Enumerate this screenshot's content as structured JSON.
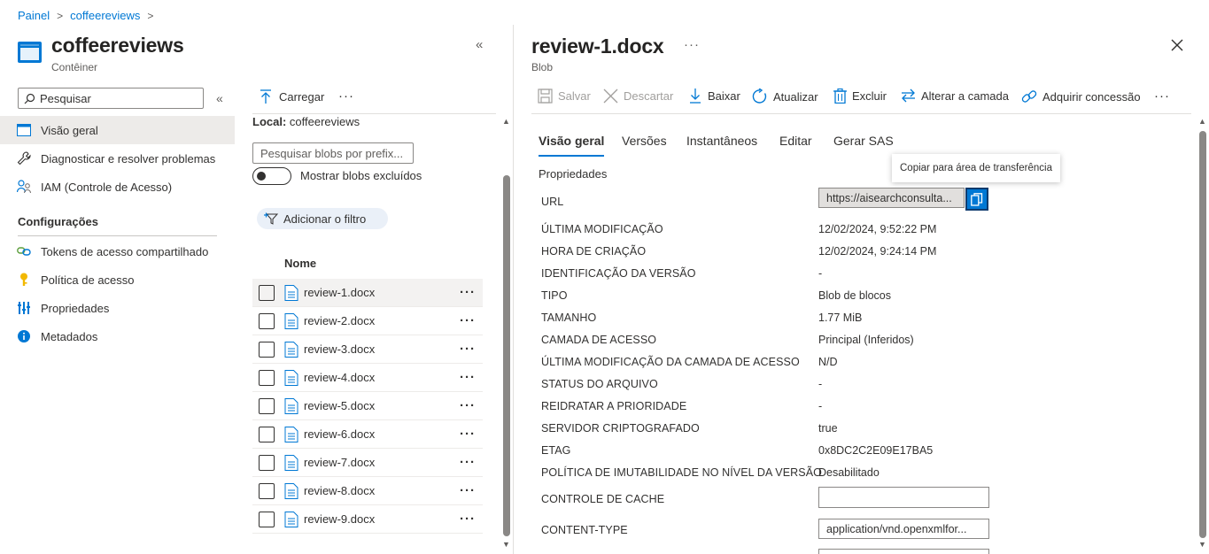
{
  "breadcrumb": [
    "Painel",
    "coffeereviews"
  ],
  "container": {
    "title": "coffeereviews",
    "subtitle": "Contêiner"
  },
  "nav": {
    "search_placeholder": "Pesquisar",
    "items": [
      {
        "label": "Visão geral",
        "icon": "overview-icon",
        "selected": true
      },
      {
        "label": "Diagnosticar e resolver problemas",
        "icon": "wrench-icon"
      },
      {
        "label": "IAM (Controle de Acesso)",
        "icon": "people-icon"
      }
    ],
    "section": "Configurações",
    "settings": [
      {
        "label": "Tokens de acesso compartilhado",
        "icon": "link-icon"
      },
      {
        "label": "Política de acesso",
        "icon": "key-icon"
      },
      {
        "label": "Propriedades",
        "icon": "properties-icon"
      },
      {
        "label": "Metadados",
        "icon": "info-icon"
      }
    ]
  },
  "blobs": {
    "upload_label": "Carregar",
    "local_label": "Local:",
    "local_value": "coffeereviews",
    "search_placeholder": "Pesquisar blobs por prefix...",
    "toggle_label": "Mostrar blobs excluídos",
    "filter_label": "Adicionar o filtro",
    "column_header": "Nome",
    "files": [
      "review-1.docx",
      "review-2.docx",
      "review-3.docx",
      "review-4.docx",
      "review-5.docx",
      "review-6.docx",
      "review-7.docx",
      "review-8.docx",
      "review-9.docx"
    ],
    "selected_index": 0
  },
  "blade": {
    "title": "review-1.docx",
    "subtitle": "Blob",
    "commands": {
      "save": "Salvar",
      "discard": "Descartar",
      "download": "Baixar",
      "refresh": "Atualizar",
      "delete": "Excluir",
      "change_tier": "Alterar a camada",
      "lease": "Adquirir concessão"
    },
    "tabs": [
      "Visão geral",
      "Versões",
      "Instantâneos",
      "Editar",
      "Gerar SAS"
    ],
    "properties_title": "Propriedades",
    "tooltip": "Copiar para área de transferência",
    "url_label": "URL",
    "url_value": "https://aisearchconsulta...",
    "properties": [
      {
        "label": "ÚLTIMA MODIFICAÇÃO",
        "value": "12/02/2024, 9:52:22 PM"
      },
      {
        "label": "HORA DE CRIAÇÃO",
        "value": "12/02/2024, 9:24:14 PM"
      },
      {
        "label": "IDENTIFICAÇÃO DA VERSÃO",
        "value": "-"
      },
      {
        "label": "TIPO",
        "value": "Blob de blocos"
      },
      {
        "label": "TAMANHO",
        "value": "1.77 MiB"
      },
      {
        "label": "CAMADA DE ACESSO",
        "value": "Principal (Inferidos)"
      },
      {
        "label": "ÚLTIMA MODIFICAÇÃO DA CAMADA DE ACESSO",
        "value": "N/D"
      },
      {
        "label": "STATUS DO ARQUIVO",
        "value": "-"
      },
      {
        "label": "REIDRATAR A PRIORIDADE",
        "value": "-"
      },
      {
        "label": "SERVIDOR CRIPTOGRAFADO",
        "value": "true"
      },
      {
        "label": "ETAG",
        "value": "0x8DC2C2E09E17BA5"
      },
      {
        "label": "POLÍTICA DE IMUTABILIDADE NO NÍVEL DA VERSÃO",
        "value": "Desabilitado"
      }
    ],
    "cache_control_label": "CONTROLE DE CACHE",
    "cache_control_value": "",
    "content_type_label": "CONTENT-TYPE",
    "content_type_value": "application/vnd.openxmlfor..."
  },
  "colors": {
    "accent": "#0078d4",
    "selected_bg": "#edebe9"
  }
}
